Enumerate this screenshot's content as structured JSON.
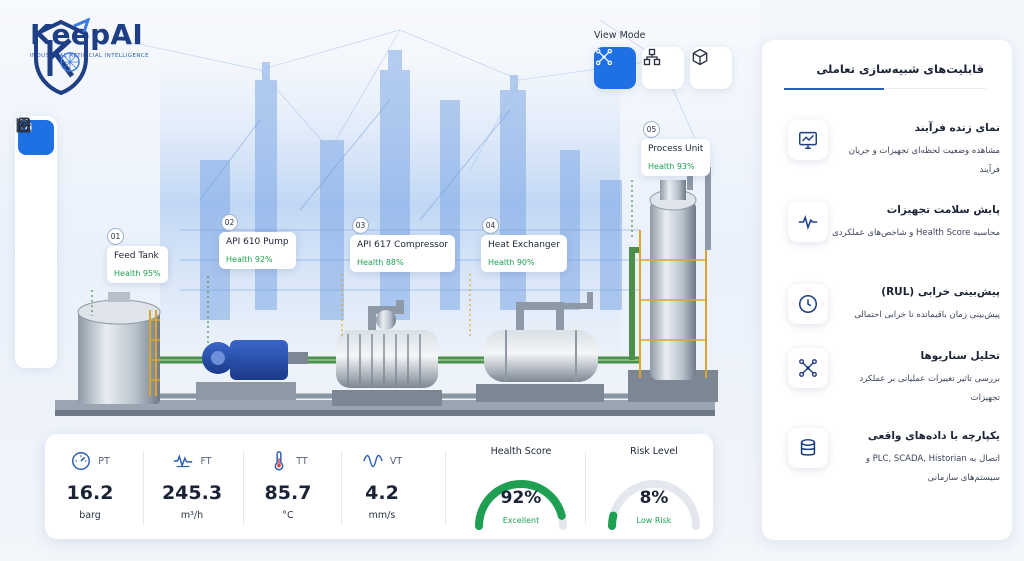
{
  "brand": {
    "name": "KeepAI",
    "tagline": "INDUSTRIAL ARTIFICIAL INTELLIGENCE"
  },
  "sidebar": {
    "items": [
      {
        "icon": "home-icon",
        "active": true
      },
      {
        "icon": "chart-icon",
        "active": false
      },
      {
        "icon": "bell-icon",
        "active": false
      },
      {
        "icon": "database-icon",
        "active": false
      },
      {
        "icon": "gear-icon",
        "active": false
      },
      {
        "icon": "report-icon",
        "active": false
      }
    ]
  },
  "view_mode": {
    "label": "View Mode",
    "options": [
      {
        "icon": "network-icon",
        "active": true
      },
      {
        "icon": "hierarchy-icon",
        "active": false
      },
      {
        "icon": "cube-icon",
        "active": false
      }
    ]
  },
  "equipment": [
    {
      "number": "01",
      "name": "Feed Tank",
      "health": "Health 95%"
    },
    {
      "number": "02",
      "name": "API 610 Pump",
      "health": "Health 92%"
    },
    {
      "number": "03",
      "name": "API 617 Compressor",
      "health": "Health 88%"
    },
    {
      "number": "04",
      "name": "Heat Exchanger",
      "health": "Health 90%"
    },
    {
      "number": "05",
      "name": "Process Unit",
      "health": "Health 93%"
    }
  ],
  "metrics": [
    {
      "tag": "PT",
      "value": "16.2",
      "unit": "barg",
      "icon": "gauge-icon"
    },
    {
      "tag": "FT",
      "value": "245.3",
      "unit": "m³/h",
      "icon": "flow-icon"
    },
    {
      "tag": "TT",
      "value": "85.7",
      "unit": "°C",
      "icon": "thermometer-icon"
    },
    {
      "tag": "VT",
      "value": "4.2",
      "unit": "mm/s",
      "icon": "vibration-icon"
    }
  ],
  "health_score": {
    "title": "Health Score",
    "value": "92%",
    "status": "Excellent",
    "fraction": 0.92,
    "color": "#1e9f52"
  },
  "risk_level": {
    "title": "Risk Level",
    "value": "8%",
    "status": "Low Risk",
    "fraction": 0.08,
    "color": "#1e9f52"
  },
  "panel": {
    "title": "قابلیت‌های شبیه‌سازی تعاملی",
    "features": [
      {
        "title": "نمای زنده فرآیند",
        "desc": "مشاهده وضعیت لحظه‌ای تجهیزات و جریان فرآیند",
        "icon": "monitor-chart-icon"
      },
      {
        "title": "پایش سلامت تجهیزات",
        "desc": "محاسبه Health Score و شاخص‌های عملکردی",
        "icon": "heartbeat-icon"
      },
      {
        "title": "پیش‌بینی خرابی (RUL)",
        "desc": "پیش‌بینی زمان باقیمانده تا خرابی احتمالی",
        "icon": "clock-icon"
      },
      {
        "title": "تحلیل سناریوها",
        "desc": "بررسی تاثیر تغییرات عملیاتی بر عملکرد تجهیزات",
        "icon": "network-icon"
      },
      {
        "title": "یکپارچه با داده‌های واقعی",
        "desc": "اتصال به PLC, SCADA, Historian و سیستم‌های سازمانی",
        "icon": "database-icon"
      }
    ]
  },
  "colors": {
    "accent": "#1f6fe5",
    "brand": "#1e3f86",
    "good": "#1e9f52"
  }
}
